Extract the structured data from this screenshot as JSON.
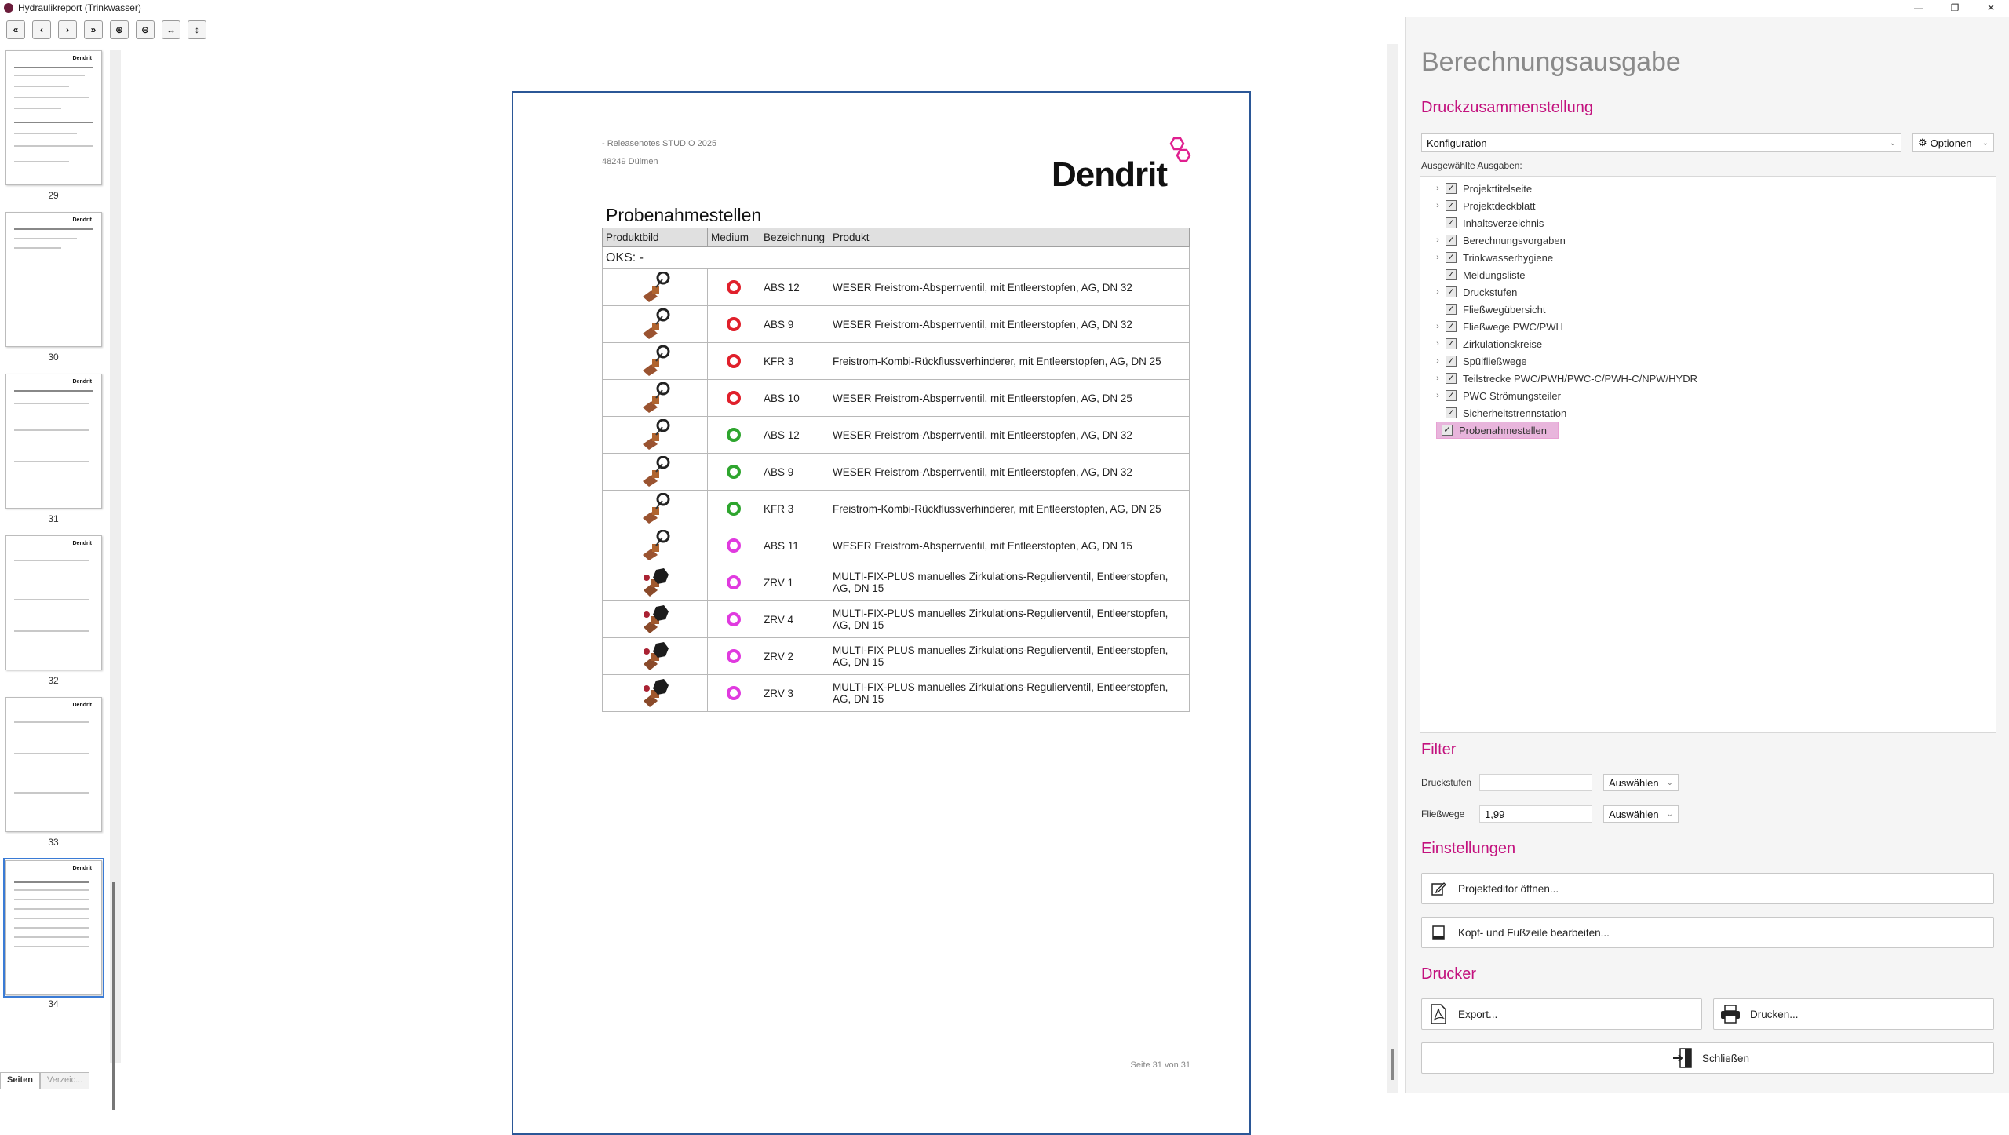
{
  "window": {
    "title": "Hydraulikreport (Trinkwasser)",
    "controls": [
      "—",
      "❐",
      "✕"
    ]
  },
  "toolbar": {
    "buttons": [
      "«",
      "‹",
      "›",
      "»",
      "⊕",
      "⊖",
      "↔",
      "↕"
    ]
  },
  "thumbnails": {
    "pages": [
      "29",
      "30",
      "31",
      "32",
      "33",
      "34"
    ],
    "tabs": {
      "pages": "Seiten",
      "toc": "Verzeic..."
    }
  },
  "document": {
    "header_line1": "- Releasenotes STUDIO 2025",
    "header_line2": "48249 Dülmen",
    "brand": "Dendrit",
    "title": "Probenahmestellen",
    "columns": [
      "Produktbild",
      "Medium",
      "Bezeichnung",
      "Produkt"
    ],
    "group": "OKS: -",
    "rows": [
      {
        "medium": "red",
        "bezeichnung": "ABS 12",
        "produkt": "WESER Freistrom-Absperrventil, mit Entleerstopfen, AG, DN 32",
        "img": "valve"
      },
      {
        "medium": "red",
        "bezeichnung": "ABS 9",
        "produkt": "WESER Freistrom-Absperrventil, mit Entleerstopfen, AG, DN 32",
        "img": "valve"
      },
      {
        "medium": "red",
        "bezeichnung": "KFR 3",
        "produkt": "Freistrom-Kombi-Rückflussverhinderer, mit Entleerstopfen, AG, DN 25",
        "img": "valve"
      },
      {
        "medium": "red",
        "bezeichnung": "ABS 10",
        "produkt": "WESER Freistrom-Absperrventil, mit Entleerstopfen, AG, DN 25",
        "img": "valve"
      },
      {
        "medium": "green",
        "bezeichnung": "ABS 12",
        "produkt": "WESER Freistrom-Absperrventil, mit Entleerstopfen, AG, DN 32",
        "img": "valve"
      },
      {
        "medium": "green",
        "bezeichnung": "ABS 9",
        "produkt": "WESER Freistrom-Absperrventil, mit Entleerstopfen, AG, DN 32",
        "img": "valve"
      },
      {
        "medium": "green",
        "bezeichnung": "KFR 3",
        "produkt": "Freistrom-Kombi-Rückflussverhinderer, mit Entleerstopfen, AG, DN 25",
        "img": "valve"
      },
      {
        "medium": "pink",
        "bezeichnung": "ABS 11",
        "produkt": "WESER Freistrom-Absperrventil, mit Entleerstopfen, AG, DN 15",
        "img": "valve"
      },
      {
        "medium": "pink",
        "bezeichnung": "ZRV 1",
        "produkt": "MULTI-FIX-PLUS manuelles Zirkulations-Regulierventil, Entleerstopfen, AG, DN 15",
        "img": "zrv"
      },
      {
        "medium": "pink",
        "bezeichnung": "ZRV 4",
        "produkt": "MULTI-FIX-PLUS manuelles Zirkulations-Regulierventil, Entleerstopfen, AG, DN 15",
        "img": "zrv"
      },
      {
        "medium": "pink",
        "bezeichnung": "ZRV 2",
        "produkt": "MULTI-FIX-PLUS manuelles Zirkulations-Regulierventil, Entleerstopfen, AG, DN 15",
        "img": "zrv"
      },
      {
        "medium": "pink",
        "bezeichnung": "ZRV 3",
        "produkt": "MULTI-FIX-PLUS manuelles Zirkulations-Regulierventil, Entleerstopfen, AG, DN 15",
        "img": "zrv"
      }
    ],
    "footer": "Seite 31 von 31"
  },
  "panel": {
    "title": "Berechnungsausgabe",
    "section_print": "Druckzusammenstellung",
    "config_value": "Konfiguration",
    "options_label": "Optionen",
    "selected_outputs_label": "Ausgewählte Ausgaben:",
    "tree": [
      {
        "label": "Projekttitelseite",
        "expandable": true
      },
      {
        "label": "Projektdeckblatt",
        "expandable": true
      },
      {
        "label": "Inhaltsverzeichnis",
        "expandable": false
      },
      {
        "label": "Berechnungsvorgaben",
        "expandable": true
      },
      {
        "label": "Trinkwasserhygiene",
        "expandable": true
      },
      {
        "label": "Meldungsliste",
        "expandable": false
      },
      {
        "label": "Druckstufen",
        "expandable": true
      },
      {
        "label": "Fließwegübersicht",
        "expandable": false
      },
      {
        "label": "Fließwege PWC/PWH",
        "expandable": true
      },
      {
        "label": "Zirkulationskreise",
        "expandable": true
      },
      {
        "label": "Spülfließwege",
        "expandable": true
      },
      {
        "label": "Teilstrecke PWC/PWH/PWC-C/PWH-C/NPW/HYDR",
        "expandable": true
      },
      {
        "label": "PWC Strömungsteiler",
        "expandable": true
      },
      {
        "label": "Sicherheitstrennstation",
        "expandable": false
      },
      {
        "label": "Probenahmestellen",
        "expandable": false,
        "selected": true
      }
    ],
    "section_filter": "Filter",
    "filter_druckstufen_label": "Druckstufen",
    "filter_druckstufen_value": "",
    "filter_fliesswege_label": "Fließwege",
    "filter_fliesswege_value": "1,99",
    "select_label": "Auswählen",
    "section_settings": "Einstellungen",
    "btn_project_editor": "Projekteditor öffnen...",
    "btn_header_footer": "Kopf- und Fußzeile bearbeiten...",
    "section_printer": "Drucker",
    "btn_export": "Export...",
    "btn_print": "Drucken...",
    "btn_close": "Schließen"
  },
  "colors": {
    "accent": "#c3127e",
    "medium_red": "#e0202b",
    "medium_green": "#2ea52e",
    "medium_pink": "#e03adf",
    "selection": "#e8b5dc"
  }
}
